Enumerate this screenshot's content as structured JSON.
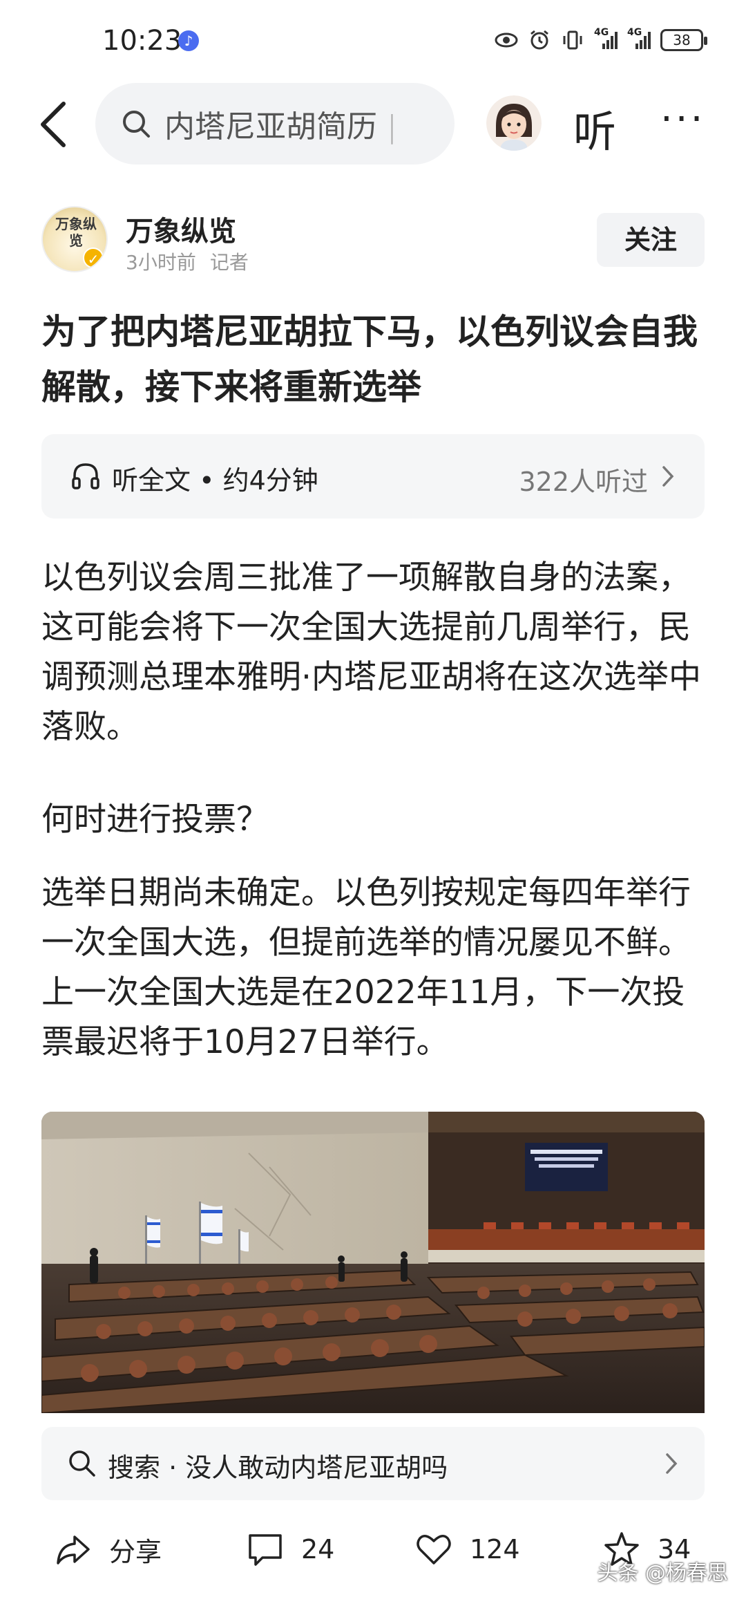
{
  "status_bar": {
    "time": "10:23",
    "network_1": "4G",
    "network_2": "4G",
    "battery": "38"
  },
  "top_bar": {
    "search_text": "内塔尼亚胡简历",
    "listen_label": "听",
    "more_label": "···"
  },
  "author": {
    "logo_text": "万象纵览",
    "name": "万象纵览",
    "time": "3小时前",
    "role": "记者",
    "follow_label": "关注"
  },
  "article": {
    "title": "为了把内塔尼亚胡拉下马，以色列议会自我解散，接下来将重新选举",
    "listen_label": "听全文 • 约4分钟",
    "listen_count": "322人听过",
    "paragraphs": [
      "以色列议会周三批准了一项解散自身的法案，这可能会将下一次全国大选提前几周举行，民调预测总理本雅明·内塔尼亚胡将在这次选举中落败。",
      "何时进行投票？",
      "选举日期尚未确定。以色列按规定每四年举行一次全国大选，但提前选举的情况屡见不鲜。上一次全国大选是在2022年11月，下一次投票最迟将于10月27日举行。"
    ]
  },
  "related_search": {
    "text": "搜索 · 没人敢动内塔尼亚胡吗"
  },
  "actions": {
    "share": "分享",
    "comments": "24",
    "likes": "124",
    "favorites": "34"
  },
  "watermark": "头条 @杨春思"
}
